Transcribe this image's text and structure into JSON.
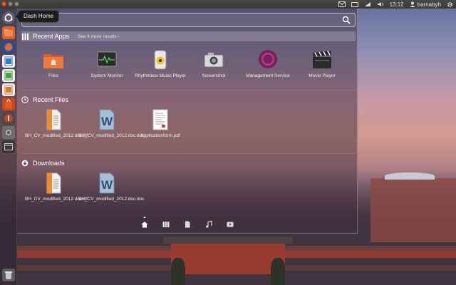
{
  "panel": {
    "time": "13:12",
    "user": "barnabyh"
  },
  "tooltip": {
    "text": "Dash Home"
  },
  "search": {
    "value": "",
    "placeholder": ""
  },
  "recent_apps": {
    "title": "Recent Apps",
    "more": "See 6 more results",
    "items": [
      {
        "label": "Files",
        "icon": "files-icon"
      },
      {
        "label": "System Monitor",
        "icon": "system-monitor-icon"
      },
      {
        "label": "Rhythmbox Music Player",
        "icon": "rhythmbox-icon"
      },
      {
        "label": "Screenshot",
        "icon": "screenshot-icon"
      },
      {
        "label": "Management Service",
        "icon": "management-service-icon"
      },
      {
        "label": "Movie Player",
        "icon": "movie-player-icon"
      }
    ]
  },
  "recent_files": {
    "title": "Recent Files",
    "items": [
      {
        "label": "BH_CV_modified_2012.doc.rtf",
        "icon": "rtf-document-icon"
      },
      {
        "label": "BH_CV_modified_2012.doc.doc",
        "icon": "word-document-icon"
      },
      {
        "label": "Applicationform.pdf",
        "icon": "pdf-document-icon"
      }
    ]
  },
  "downloads": {
    "title": "Downloads",
    "items": [
      {
        "label": "BH_CV_modified_2012.doc.rtf",
        "icon": "rtf-document-icon"
      },
      {
        "label": "BH_CV_modified_2012.doc.doc",
        "icon": "word-document-icon"
      }
    ]
  },
  "lenses": [
    "home-lens-icon",
    "applications-lens-icon",
    "files-lens-icon",
    "music-lens-icon",
    "video-lens-icon"
  ],
  "colors": {
    "ubuntu_orange": "#e95420",
    "panel": "#3c3b37"
  }
}
